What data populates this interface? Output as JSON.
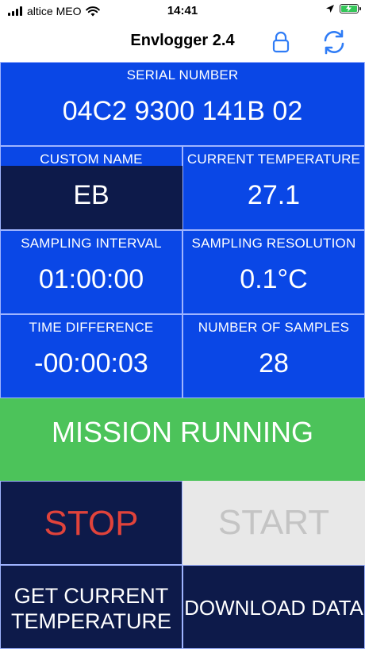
{
  "status_bar": {
    "carrier": "altice MEO",
    "time": "14:41"
  },
  "nav": {
    "title": "Envlogger 2.4"
  },
  "serial": {
    "label": "SERIAL NUMBER",
    "value": "04C2 9300 141B 02"
  },
  "fields": {
    "custom_name": {
      "label": "CUSTOM NAME",
      "value": "EB"
    },
    "current_temperature": {
      "label": "CURRENT TEMPERATURE",
      "value": "27.1"
    },
    "sampling_interval": {
      "label": "SAMPLING INTERVAL",
      "value": "01:00:00"
    },
    "sampling_resolution": {
      "label": "SAMPLING RESOLUTION",
      "value": "0.1°C"
    },
    "time_difference": {
      "label": "TIME DIFFERENCE",
      "value": "-00:00:03"
    },
    "number_of_samples": {
      "label": "NUMBER OF SAMPLES",
      "value": "28"
    }
  },
  "mission": {
    "status": "MISSION RUNNING"
  },
  "buttons": {
    "stop": "STOP",
    "start": "START",
    "get_current_temperature_line1": "GET CURRENT",
    "get_current_temperature_line2": "TEMPERATURE",
    "download_data": "DOWNLOAD DATA"
  },
  "colors": {
    "blue": "#0a47e6",
    "dark_navy": "#0d1a4a",
    "green": "#4cc35a",
    "stop_red": "#e0433b",
    "disabled_gray": "#e8e8e8"
  }
}
